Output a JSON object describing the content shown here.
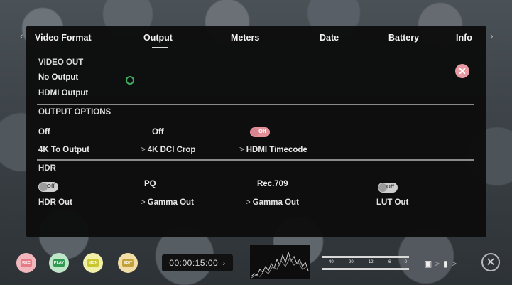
{
  "tabs": [
    {
      "label": "Video Format"
    },
    {
      "label": "Output"
    },
    {
      "label": "Meters"
    },
    {
      "label": "Date"
    },
    {
      "label": "Battery"
    },
    {
      "label": "Info"
    }
  ],
  "active_tab": "Output",
  "video_out": {
    "heading": "VIDEO OUT",
    "status": "No Output",
    "name": "HDMI Output",
    "status_color": "#3fae63"
  },
  "output_options": {
    "heading": "OUTPUT OPTIONS",
    "items": [
      {
        "value": "Off",
        "label": "4K To Output"
      },
      {
        "value": "Off",
        "label": "4K DCI Crop"
      },
      {
        "toggle": "Off",
        "label": "HDMI Timecode"
      }
    ]
  },
  "hdr": {
    "heading": "HDR",
    "items": [
      {
        "toggle": "Off",
        "label": "HDR Out"
      },
      {
        "value": "PQ",
        "label": "Gamma Out"
      },
      {
        "value": "Rec.709",
        "label": "Gamma Out"
      },
      {
        "toggle": "Off",
        "label": "LUT Out"
      }
    ]
  },
  "chevron": ">",
  "bottom_bar": {
    "buttons": [
      {
        "label": "REC",
        "ring": "#f2b7bd",
        "core": "#e57b86"
      },
      {
        "label": "PLAY",
        "ring": "#bfe6c9",
        "core": "#2f9b52"
      },
      {
        "label": "MON",
        "ring": "#f1f0a9",
        "core": "#c9c630"
      },
      {
        "label": "EDIT",
        "ring": "#f2dda6",
        "core": "#c3a03a"
      }
    ],
    "timecode": "00:00:15:00",
    "timecode_arrow": "›",
    "meter_scale": [
      "-40",
      "-20",
      "-12",
      "-6",
      "0"
    ],
    "icons": [
      "folder-icon",
      "play-icon",
      "close-icon"
    ]
  },
  "colors": {
    "panel": "#0c0c0c",
    "close_accent": "#e89aa2",
    "toggle_on": "#e58f99",
    "toggle_off": "#cfcfcf"
  }
}
